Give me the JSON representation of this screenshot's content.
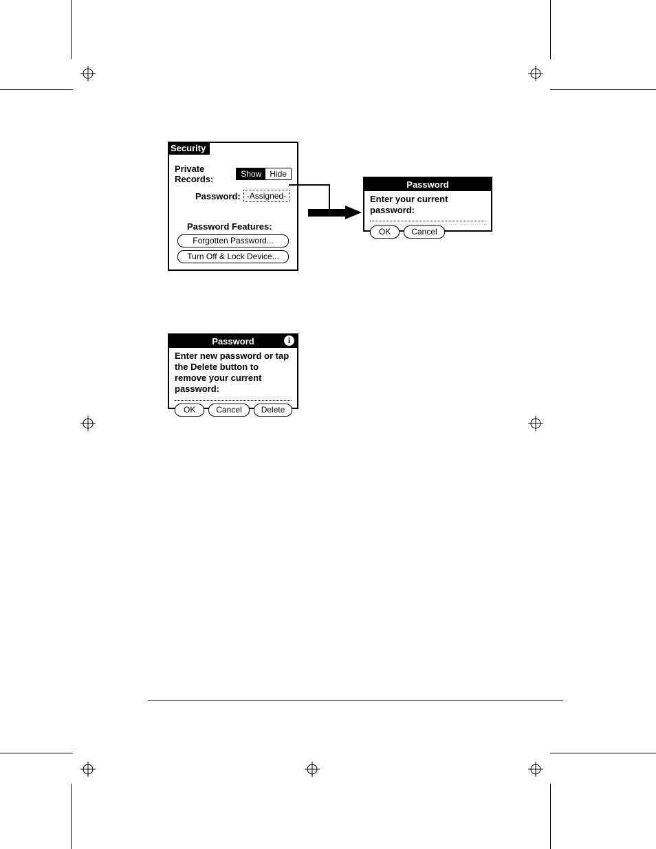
{
  "security_panel": {
    "title": "Security",
    "private_records_label": "Private Records:",
    "show_label": "Show",
    "hide_label": "Hide",
    "password_label": "Password:",
    "password_value": "-Assigned-",
    "features_label": "Password Features:",
    "forgotten_btn": "Forgotten Password...",
    "lock_btn": "Turn Off & Lock Device..."
  },
  "current_pw_dialog": {
    "title": "Password",
    "prompt": "Enter your current password:",
    "ok": "OK",
    "cancel": "Cancel"
  },
  "new_pw_dialog": {
    "title": "Password",
    "prompt": "Enter new password or tap the Delete button to remove your current password:",
    "ok": "OK",
    "cancel": "Cancel",
    "delete": "Delete"
  }
}
